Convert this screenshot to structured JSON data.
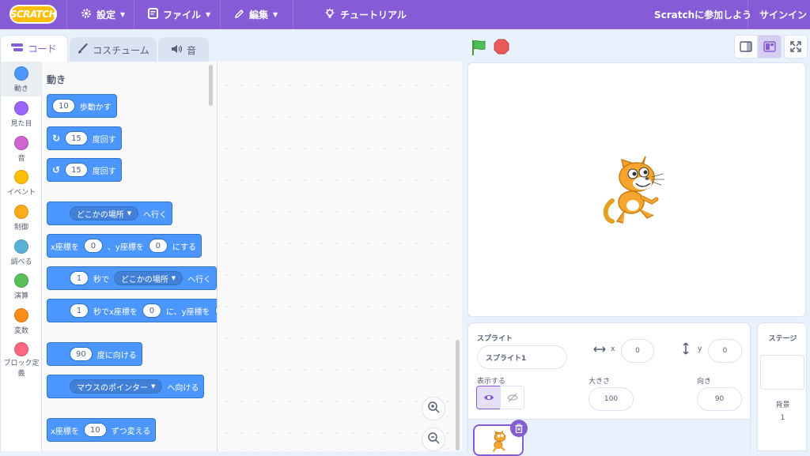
{
  "menubar": {
    "logo_text": "SCRATCH",
    "settings": "設定",
    "file": "ファイル",
    "edit": "編集",
    "tutorial": "チュートリアル",
    "join": "Scratchに参加しよう",
    "signin": "サインイン"
  },
  "tabs": [
    {
      "label": "コード",
      "icon": "code-icon"
    },
    {
      "label": "コスチューム",
      "icon": "brush-icon"
    },
    {
      "label": "音",
      "icon": "speaker-icon"
    }
  ],
  "categories": [
    {
      "label": "動き",
      "color": "#4c97ff"
    },
    {
      "label": "見た目",
      "color": "#9966ff"
    },
    {
      "label": "音",
      "color": "#cf63cf"
    },
    {
      "label": "イベント",
      "color": "#ffbf00"
    },
    {
      "label": "制御",
      "color": "#ffab19"
    },
    {
      "label": "調べる",
      "color": "#5cb1d6"
    },
    {
      "label": "演算",
      "color": "#59c059"
    },
    {
      "label": "変数",
      "color": "#ff8c1a"
    },
    {
      "label": "ブロック定義",
      "color": "#ff6680"
    }
  ],
  "palette": {
    "section_title": "動き",
    "move_steps": {
      "value": "10",
      "text": "歩動かす"
    },
    "turn_right": {
      "value": "15",
      "text": "度回す"
    },
    "turn_left": {
      "value": "15",
      "text": "度回す"
    },
    "goto": {
      "dropdown": "どこかの場所",
      "text": "へ行く"
    },
    "goto_xy": {
      "t1": "x座標を",
      "x": "0",
      "t2": "、y座標を",
      "y": "0",
      "t3": "にする"
    },
    "glide": {
      "value": "1",
      "t1": "秒で",
      "dropdown": "どこかの場所",
      "t2": "へ行く"
    },
    "glide_xy": {
      "value": "1",
      "t1": "秒でx座標を",
      "x": "0",
      "t2": "に、y座標を"
    },
    "point_dir": {
      "value": "90",
      "text": "度に向ける"
    },
    "point_towards": {
      "dropdown": "マウスのポインター",
      "text": "へ向ける"
    },
    "change_x": {
      "t1": "x座標を",
      "value": "10",
      "t2": "ずつ変える"
    }
  },
  "sprite_info": {
    "title": "スプライト",
    "name": "スプライト1",
    "x_label": "x",
    "x": "0",
    "y_label": "y",
    "y": "0",
    "show_label": "表示する",
    "size_label": "大きさ",
    "size": "100",
    "direction_label": "向き",
    "direction": "90"
  },
  "stage_pane": {
    "title": "ステージ",
    "backdrop_label": "背景",
    "backdrop_count": "1"
  },
  "colors": {
    "menubar": "#855cd6",
    "motion": "#4c97ff",
    "flag": "#4cbf56",
    "stop": "#ec5959"
  }
}
